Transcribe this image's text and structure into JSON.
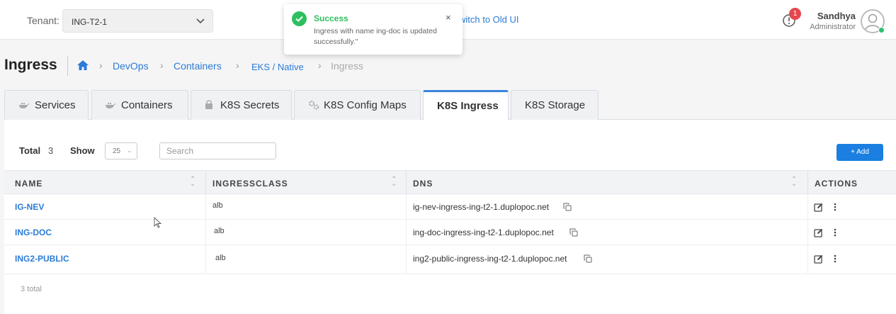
{
  "topbar": {
    "tenant_label": "Tenant:",
    "tenant_value": "ING-T2-1",
    "old_ui_link": "witch to Old UI",
    "alert_count": "1",
    "user_name": "Sandhya",
    "user_role": "Administrator"
  },
  "toast": {
    "title": "Success",
    "message": "Ingress with name ing-doc is updated successfully.\"",
    "close": "×"
  },
  "breadcrumb": {
    "page_title": "Ingress",
    "items": [
      "DevOps",
      "Containers",
      "EKS / Native",
      "Ingress"
    ],
    "separator": "›"
  },
  "tabs": [
    {
      "label": "Services",
      "icon": "docker-icon"
    },
    {
      "label": "Containers",
      "icon": "docker-icon"
    },
    {
      "label": "K8S Secrets",
      "icon": "lock-icon"
    },
    {
      "label": "K8S Config Maps",
      "icon": "gears-icon"
    },
    {
      "label": "K8S Ingress",
      "active": true
    },
    {
      "label": "K8S Storage"
    }
  ],
  "toolbar": {
    "total_label": "Total",
    "total_value": "3",
    "show_label": "Show",
    "show_value": "25",
    "search_placeholder": "Search",
    "add_label": "+ Add"
  },
  "table": {
    "columns": [
      "NAME",
      "INGRESSCLASS",
      "DNS",
      "ACTIONS"
    ],
    "rows": [
      {
        "name": "IG-NEV",
        "ingressclass": "alb",
        "dns": "ig-nev-ingress-ing-t2-1.duplopoc.net"
      },
      {
        "name": "ING-DOC",
        "ingressclass": "alb",
        "dns": "ing-doc-ingress-ing-t2-1.duplopoc.net"
      },
      {
        "name": "ING2-PUBLIC",
        "ingressclass": "alb",
        "dns": "ing2-public-ingress-ing-t2-1.duplopoc.net"
      }
    ],
    "footer": "3 total"
  },
  "colors": {
    "accent": "#2c7bd6",
    "success": "#2ebf5f",
    "badge": "#e5484d",
    "add_button": "#1a7fe0"
  }
}
